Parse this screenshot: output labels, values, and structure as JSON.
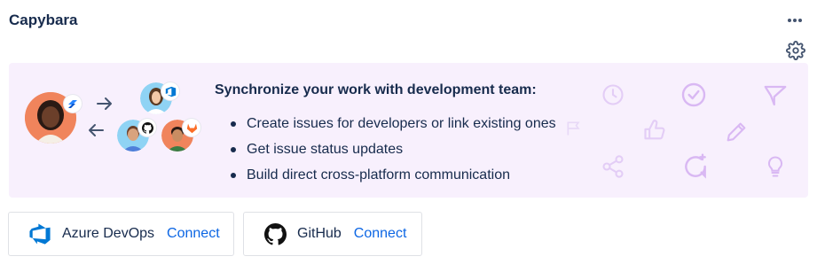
{
  "header": {
    "title": "Capybara",
    "more_icon": "more-horizontal-icon",
    "settings_icon": "gear-icon"
  },
  "banner": {
    "headline": "Synchronize your work with development team:",
    "bullets": [
      "Create issues for developers or link existing ones",
      "Get issue status updates",
      "Build direct cross-platform communication"
    ],
    "background": "#f8f0fd",
    "decor_color": "#d9b8f3"
  },
  "integrations": [
    {
      "name": "Azure DevOps",
      "action": "Connect",
      "icon": "azure-devops-icon"
    },
    {
      "name": "GitHub",
      "action": "Connect",
      "icon": "github-icon"
    }
  ],
  "colors": {
    "text": "#172b4d",
    "link": "#0c66e4",
    "azure": "#0078d4"
  }
}
